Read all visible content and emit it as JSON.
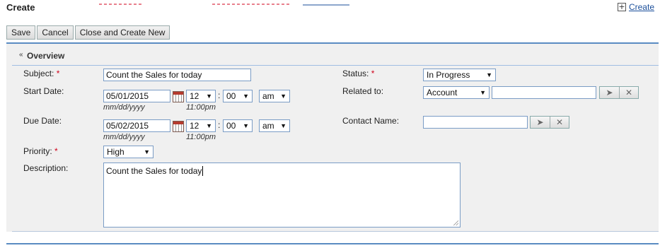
{
  "header": {
    "title": "Create",
    "create_link": "Create"
  },
  "toolbar": {
    "save": "Save",
    "cancel": "Cancel",
    "close_create_new": "Close and Create New"
  },
  "section": {
    "title": "Overview"
  },
  "fields": {
    "subject": {
      "label": "Subject:",
      "value": "Count the Sales for today"
    },
    "start_date": {
      "label": "Start Date:",
      "date": "05/01/2015",
      "hour": "12",
      "minute": "00",
      "ampm": "am",
      "date_hint": "mm/dd/yyyy",
      "time_hint": "11:00pm"
    },
    "due_date": {
      "label": "Due Date:",
      "date": "05/02/2015",
      "hour": "12",
      "minute": "00",
      "ampm": "am",
      "date_hint": "mm/dd/yyyy",
      "time_hint": "11:00pm"
    },
    "priority": {
      "label": "Priority:",
      "value": "High"
    },
    "description": {
      "label": "Description:",
      "value": "Count the Sales for today"
    },
    "status": {
      "label": "Status:",
      "value": "In Progress"
    },
    "related_to": {
      "label": "Related to:",
      "type": "Account",
      "value": ""
    },
    "contact_name": {
      "label": "Contact Name:",
      "value": ""
    }
  },
  "colon": ":",
  "required_marker": "*",
  "icons": {
    "dropdown": "chevron-down-icon",
    "calendar": "calendar-icon",
    "select": "cursor-arrow-icon",
    "clear": "x-icon",
    "collapse": "double-chevron-up-icon",
    "add": "plus-box-icon"
  },
  "colors": {
    "accent": "#5a8bc2",
    "required": "#d0021b",
    "link": "#1a4e9a"
  }
}
